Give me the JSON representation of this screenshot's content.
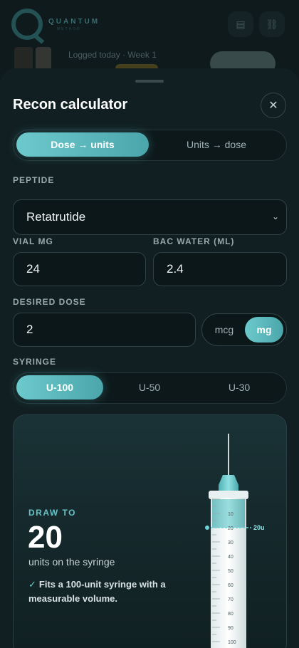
{
  "background": {
    "logo_text": "QUANTUM",
    "logo_subtext": "METHOD",
    "row_text": "Logged today · Week 1"
  },
  "sheet": {
    "title": "Recon calculator",
    "mode_tabs": [
      {
        "label": "Dose → units",
        "active": true
      },
      {
        "label": "Units → dose",
        "active": false
      }
    ],
    "peptide": {
      "label": "PEPTIDE",
      "value": "Retatrutide"
    },
    "vial_mg": {
      "label": "VIAL MG",
      "value": "24"
    },
    "bac_water": {
      "label": "BAC WATER (ML)",
      "value": "2.4"
    },
    "desired_dose": {
      "label": "DESIRED DOSE",
      "value": "2"
    },
    "dose_units": [
      {
        "label": "mcg",
        "active": false
      },
      {
        "label": "mg",
        "active": true
      }
    ],
    "syringe": {
      "label": "SYRINGE",
      "options": [
        {
          "label": "U-100",
          "active": true
        },
        {
          "label": "U-50",
          "active": false
        },
        {
          "label": "U-30",
          "active": false
        }
      ]
    },
    "result": {
      "draw_label": "DRAW TO",
      "draw_value": "20",
      "draw_sub": "units on the syringe",
      "check_icon": "✓",
      "note": "Fits a 100-unit syringe with a measurable volume.",
      "marker_label": "20u",
      "syringe_ticks": [
        "10",
        "20",
        "30",
        "40",
        "50",
        "60",
        "70",
        "80",
        "90",
        "100"
      ],
      "fill_fraction": 0.2
    }
  },
  "colors": {
    "accent": "#5ab8bc",
    "background": "#111f22"
  }
}
